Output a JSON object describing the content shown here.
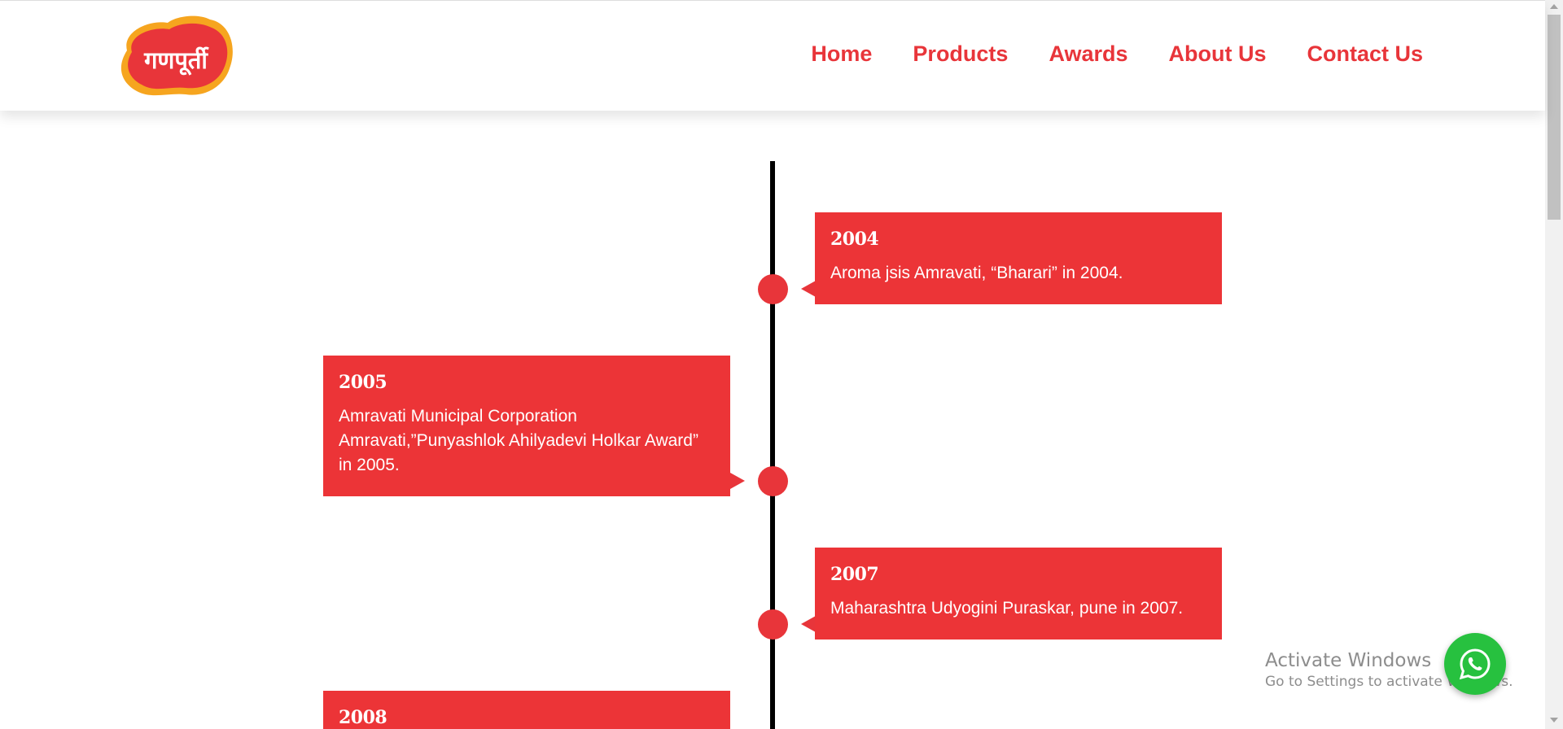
{
  "header": {
    "logo_text": "गणपूर्ती",
    "nav": [
      {
        "label": "Home"
      },
      {
        "label": "Products"
      },
      {
        "label": "Awards"
      },
      {
        "label": "About Us"
      },
      {
        "label": "Contact Us"
      }
    ]
  },
  "timeline": {
    "items": [
      {
        "year": "2004",
        "text": "Aroma jsis Amravati, “Bharari” in 2004.",
        "side": "right"
      },
      {
        "year": "2005",
        "text": "Amravati Municipal Corporation Amravati,”Punyashlok Ahilyadevi Holkar Award” in 2005.",
        "side": "left"
      },
      {
        "year": "2007",
        "text": "Maharashtra Udyogini Puraskar, pune in 2007.",
        "side": "right"
      },
      {
        "year": "2008",
        "text": "",
        "side": "left"
      }
    ]
  },
  "watermark": {
    "title": "Activate Windows",
    "subtitle": "Go to Settings to activate Windows."
  },
  "whatsapp": {
    "icon": "whatsapp-icon"
  },
  "colors": {
    "brand_red": "#e8353a",
    "card_red": "#ec3437",
    "whatsapp_green": "#27c13f"
  }
}
